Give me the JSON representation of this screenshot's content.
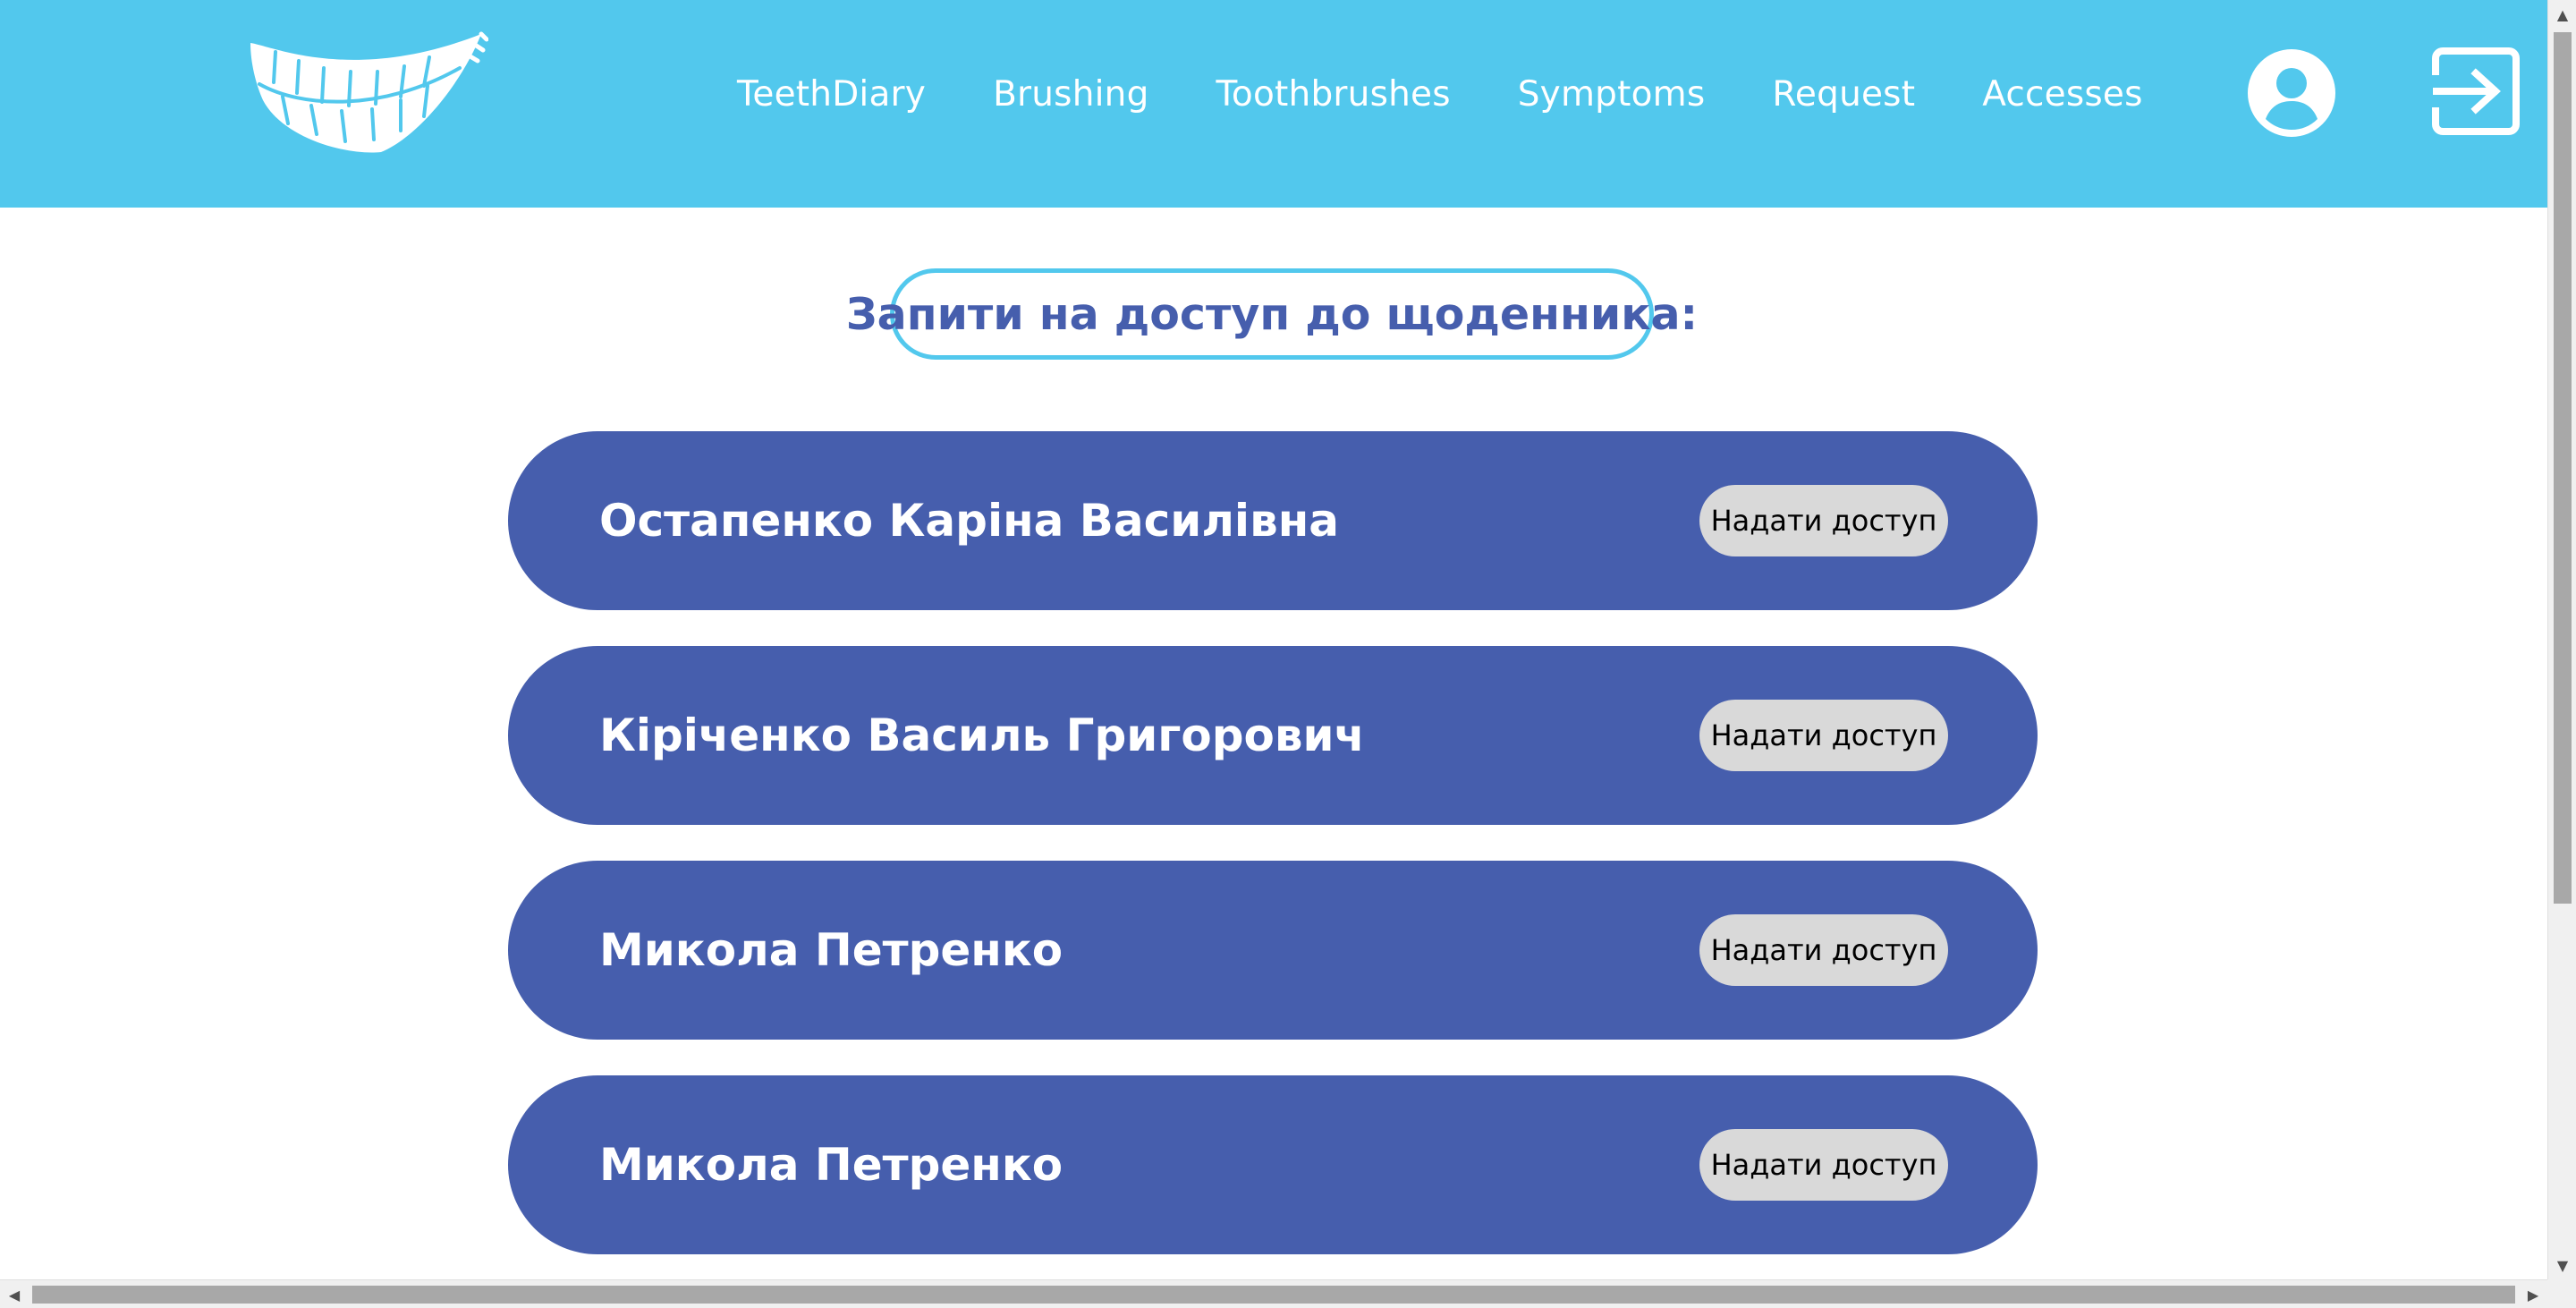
{
  "header": {
    "background_color": "#52c8ed",
    "logo_icon": "teeth-smile-logo",
    "nav": [
      {
        "label": "TeethDiary"
      },
      {
        "label": "Brushing"
      },
      {
        "label": "Toothbrushes"
      },
      {
        "label": "Symptoms"
      },
      {
        "label": "Request"
      },
      {
        "label": "Accesses"
      }
    ],
    "profile_icon": "user-avatar-icon",
    "logout_icon": "logout-icon"
  },
  "main": {
    "title": "Запити на доступ до щоденника:",
    "accent_color": "#465ead",
    "requests": [
      {
        "name": "Остапенко Каріна Василівна",
        "button_label": "Надати доступ"
      },
      {
        "name": "Кіріченко Василь Григорович",
        "button_label": "Надати доступ"
      },
      {
        "name": "Микола Петренко",
        "button_label": "Надати доступ"
      },
      {
        "name": "Микола Петренко",
        "button_label": "Надати доступ"
      }
    ]
  }
}
